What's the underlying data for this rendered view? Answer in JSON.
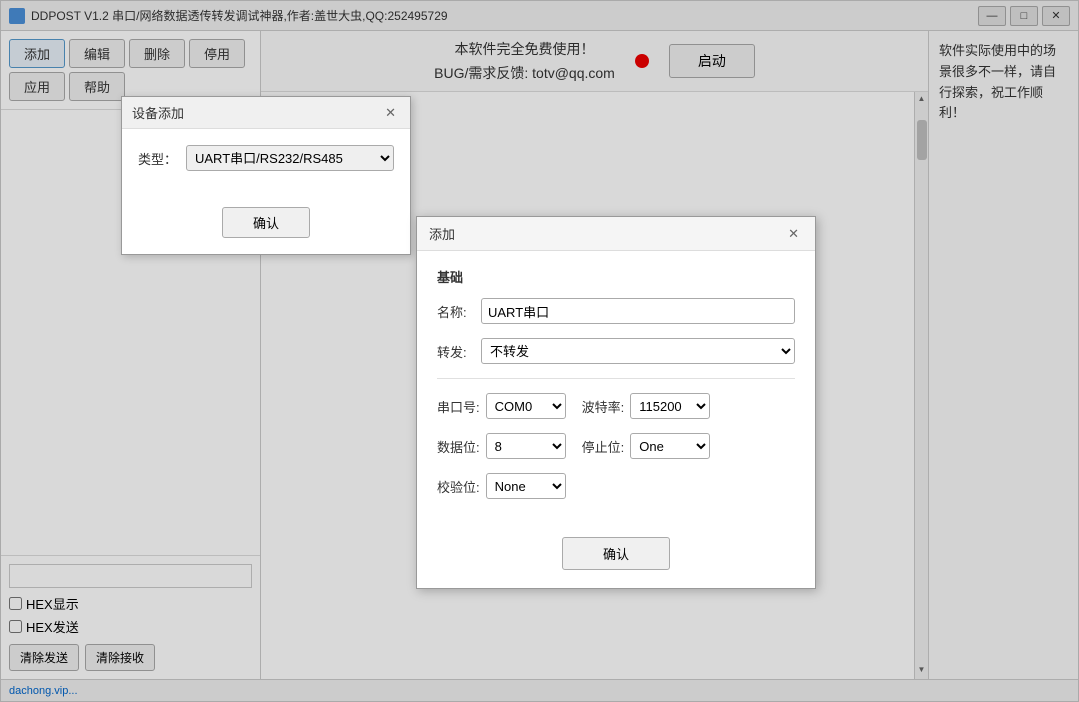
{
  "app": {
    "title": "DDPOST V1.2 串口/网络数据透传转发调试神器,作者:盖世大虫,QQ:252495729",
    "title_icon": "app-icon"
  },
  "title_controls": {
    "minimize": "—",
    "restore": "□",
    "close": "✕"
  },
  "toolbar": {
    "add_label": "添加",
    "edit_label": "编辑",
    "delete_label": "删除",
    "disable_label": "停用",
    "apply_label": "应用",
    "help_label": "帮助"
  },
  "info_bar": {
    "free_text": "本软件完全免费使用！",
    "bug_text": "BUG/需求反馈: totv@qq.com",
    "start_btn": "启动"
  },
  "right_panel": {
    "text": "软件实际使用中的场景很多不一样，请自行探索，祝工作顺利！"
  },
  "left_panel": {
    "search_placeholder": "",
    "hex_show": "HEX显示",
    "hex_send": "HEX发送",
    "clear_send": "清除发送",
    "clear_recv": "清除接收"
  },
  "status_bar": {
    "link": "dachong.vip",
    "suffix": "..."
  },
  "dialog_device_add": {
    "title": "设备添加",
    "type_label": "类型：",
    "type_value": "UART串口/RS232/RS485",
    "confirm_label": "确认"
  },
  "dialog_add_main": {
    "title": "添加",
    "section_basics": "基础",
    "name_label": "名称:",
    "name_value": "UART串口",
    "forward_label": "转发:",
    "forward_value": "不转发",
    "forward_options": [
      "不转发"
    ],
    "port_label": "串口号:",
    "port_value": "COM0",
    "baud_label": "波特率:",
    "baud_value": "115200",
    "data_bits_label": "数据位:",
    "data_bits_value": "8",
    "stop_bits_label": "停止位:",
    "stop_bits_value": "One",
    "parity_label": "校验位:",
    "parity_value": "None",
    "confirm_label": "确认"
  }
}
